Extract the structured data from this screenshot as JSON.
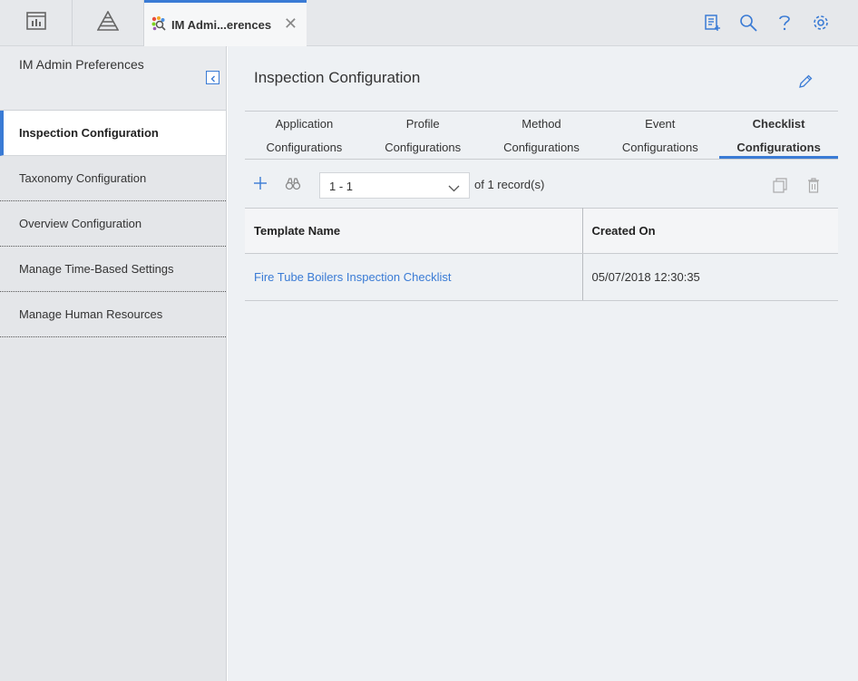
{
  "topbar": {
    "tab_title": "IM Admi...erences",
    "close_glyph": "✕"
  },
  "sidebar": {
    "header": "IM Admin Preferences",
    "items": [
      {
        "label": "Inspection Configuration",
        "active": true
      },
      {
        "label": "Taxonomy Configuration"
      },
      {
        "label": "Overview Configuration"
      },
      {
        "label": "Manage Time-Based Settings"
      },
      {
        "label": "Manage Human Resources"
      }
    ]
  },
  "main": {
    "title": "Inspection Configuration",
    "tabs": [
      {
        "line1": "Application",
        "line2": "Configurations"
      },
      {
        "line1": "Profile",
        "line2": "Configurations"
      },
      {
        "line1": "Method",
        "line2": "Configurations"
      },
      {
        "line1": "Event",
        "line2": "Configurations"
      },
      {
        "line1": "Checklist",
        "line2": "Configurations",
        "selected": true
      }
    ],
    "pager_value": "1 - 1",
    "records_text": "of 1 record(s)",
    "table": {
      "headers": [
        "Template Name",
        "Created On"
      ],
      "rows": [
        [
          "Fire Tube Boilers Inspection Checklist",
          "05/07/2018 12:30:35"
        ]
      ]
    }
  },
  "colors": {
    "accent": "#3a7bd5"
  }
}
